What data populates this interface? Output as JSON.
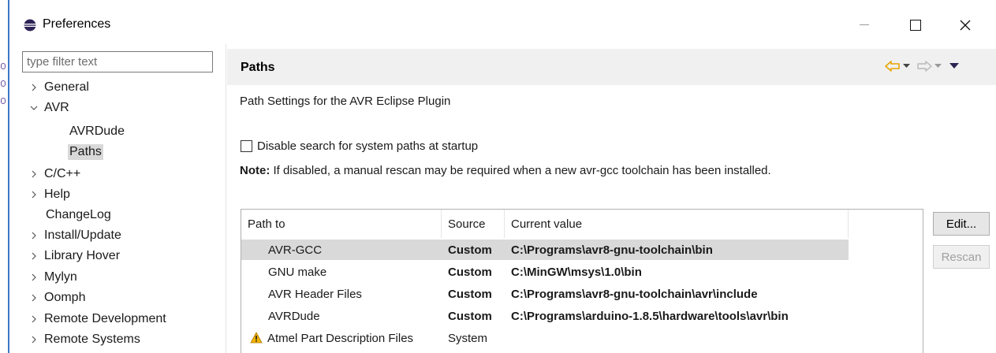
{
  "window": {
    "title": "Preferences",
    "icon": "eclipse-icon",
    "controls": [
      "minimize-icon",
      "maximize-icon",
      "close-icon"
    ]
  },
  "filter": {
    "placeholder": "type filter text",
    "value": ""
  },
  "tree": {
    "items": [
      {
        "label": "General",
        "expanded": false,
        "has_children": true
      },
      {
        "label": "AVR",
        "expanded": true,
        "has_children": true
      },
      {
        "label": "AVRDude",
        "child": true
      },
      {
        "label": "Paths",
        "child": true,
        "selected": true
      },
      {
        "label": "C/C++",
        "has_children": true
      },
      {
        "label": "Help",
        "has_children": true
      },
      {
        "label": "ChangeLog",
        "has_children": false
      },
      {
        "label": "Install/Update",
        "has_children": true
      },
      {
        "label": "Library Hover",
        "has_children": true
      },
      {
        "label": "Mylyn",
        "has_children": true
      },
      {
        "label": "Oomph",
        "has_children": true
      },
      {
        "label": "Remote Development",
        "has_children": true
      },
      {
        "label": "Remote Systems",
        "has_children": true
      }
    ]
  },
  "page": {
    "title": "Paths",
    "nav_icons": [
      "back-arrow-icon",
      "back-dropdown-icon",
      "forward-arrow-icon",
      "forward-dropdown-icon",
      "view-menu-icon"
    ],
    "description": "Path Settings for the AVR Eclipse Plugin",
    "checkbox_label": "Disable search for system paths at startup",
    "checkbox_checked": false,
    "note_label": "Note:",
    "note_text": " If disabled, a manual rescan may be required when a new avr-gcc toolchain has been installed."
  },
  "table": {
    "headers": [
      "Path to",
      "Source",
      "Current value"
    ],
    "rows": [
      {
        "path": "AVR-GCC",
        "source": "Custom",
        "value": "C:\\Programs\\avr8-gnu-toolchain\\bin",
        "selected": true
      },
      {
        "path": "GNU make",
        "source": "Custom",
        "value": "C:\\MinGW\\msys\\1.0\\bin"
      },
      {
        "path": "AVR Header Files",
        "source": "Custom",
        "value": "C:\\Programs\\avr8-gnu-toolchain\\avr\\include"
      },
      {
        "path": "AVRDude",
        "source": "Custom",
        "value": "C:\\Programs\\arduino-1.8.5\\hardware\\tools\\avr\\bin"
      },
      {
        "path": "Atmel Part Description Files",
        "source": "System",
        "value": "",
        "icon": "warning-icon"
      }
    ]
  },
  "buttons": {
    "edit": "Edit...",
    "rescan": "Rescan"
  },
  "colors": {
    "accent": "#e8a400",
    "selection": "#d9d9d9",
    "header_bg": "#f0f0f0"
  }
}
